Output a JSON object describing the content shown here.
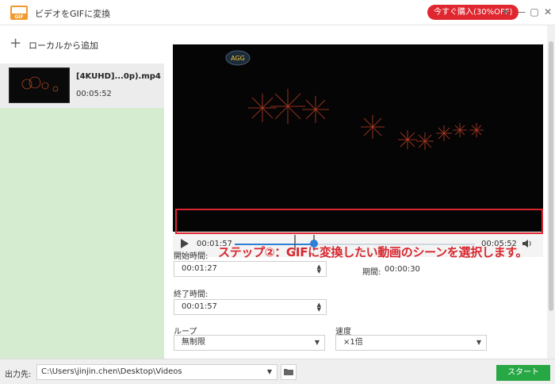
{
  "window": {
    "title": "ビデオをGIFに変換",
    "buy_button": "今すぐ購入(30%OFF)",
    "controls": [
      "▾",
      "—",
      "▢",
      "✕"
    ]
  },
  "sidebar": {
    "add_label": "ローカルから追加",
    "files": [
      {
        "name": "[4KUHD]...0p).mp4",
        "duration": "00:05:52"
      }
    ]
  },
  "player": {
    "watermark": "AGG",
    "current_time": "00:01:57",
    "total_time": "00:05:52",
    "progress": 0.33,
    "range_start": 0.25,
    "range_end": 0.33
  },
  "annotation": {
    "step_text": "ステップ②：GIFに変換したい動画のシーンを選択します。"
  },
  "form": {
    "start_label": "開始時間:",
    "start_value": "00:01:27",
    "duration_label": "期間:",
    "duration_value": "00:00:30",
    "end_label": "終了時間:",
    "end_value": "00:01:57",
    "loop_label": "ループ",
    "loop_value": "無制限",
    "speed_label": "速度",
    "speed_value": "×1倍"
  },
  "footer": {
    "output_label": "出力先:",
    "output_path": "C:\\Users\\jinjin.chen\\Desktop\\Videos",
    "start_button": "スタート"
  },
  "colors": {
    "accent_red": "#d9262e",
    "progress_blue": "#2f7fd6",
    "start_green": "#28a745",
    "sidebar_green": "#d5ecd1"
  }
}
